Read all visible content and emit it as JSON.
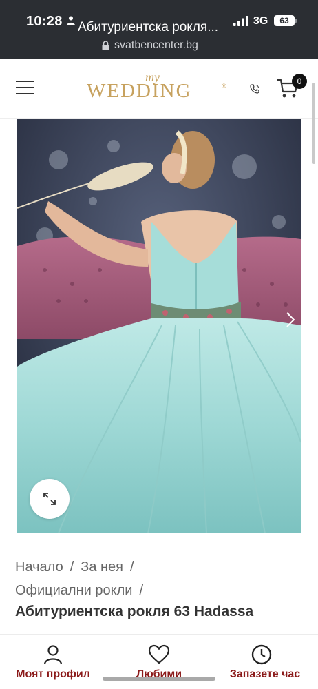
{
  "status_bar": {
    "time": "10:28",
    "tab_title": "Абитуриентска рокля...",
    "network": "3G",
    "battery": "63",
    "url": "svatbencenter.bg"
  },
  "header": {
    "logo_small": "my",
    "logo_word": "WEDDING",
    "logo_reg": "®",
    "cart_count": "0"
  },
  "breadcrumb": {
    "items": [
      "Начало",
      "За нея",
      "Официални рокли"
    ],
    "separator": "/"
  },
  "product": {
    "title": "Абитуриентска рокля 63 Hadassa"
  },
  "bottom_nav": {
    "items": [
      {
        "label": "Моят профил",
        "icon": "user-icon"
      },
      {
        "label": "Любими",
        "icon": "heart-icon"
      },
      {
        "label": "Запазете час",
        "icon": "clock-icon"
      }
    ]
  },
  "colors": {
    "brand_gold": "#c7a25f",
    "nav_label": "#8b1a1a",
    "status_bar": "#2b2e33"
  }
}
